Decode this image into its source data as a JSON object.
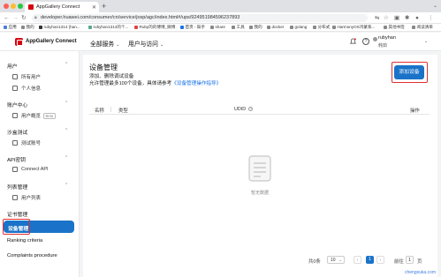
{
  "browser": {
    "tab_title": "AppGallery Connect",
    "url": "developer.huawei.com/consumer/cn/service/josp/agc/index.html#/ups/924951984596237893",
    "bookmarks": [
      "应用",
      "我的",
      "rubyhan1314 (han...",
      "rubyhan1314的个...",
      "Ruby的的博博_微博",
      "首页 - 知乎",
      "share",
      "工具",
      "我的",
      "docker",
      "golang",
      "分布式",
      "HarmonyOS鸿蒙系...",
      "其他书签",
      "阅读清单"
    ]
  },
  "header": {
    "brand": "AppGallery Connect",
    "nav": [
      "全部服务",
      "用户与访问"
    ],
    "user_name": "rubyhan",
    "user_role": "韩茹"
  },
  "sidebar": {
    "groups": [
      {
        "label": "用户",
        "items": [
          {
            "label": "所有用户"
          },
          {
            "label": "个人信息"
          }
        ]
      },
      {
        "label": "账户中心",
        "items": [
          {
            "label": "用户概览",
            "badge": "Beta"
          }
        ]
      },
      {
        "label": "沙盒测试",
        "items": [
          {
            "label": "测试账号"
          }
        ]
      },
      {
        "label": "API密钥",
        "items": [
          {
            "label": "Connect API"
          }
        ]
      },
      {
        "label": "列表管理",
        "items": [
          {
            "label": "用户列表"
          }
        ]
      },
      {
        "label": "证书管理",
        "items": []
      }
    ],
    "active_item": "设备管理",
    "bottom_items": [
      "Ranking criteria",
      "Complaints procedure"
    ]
  },
  "main": {
    "title": "设备管理",
    "desc1": "添加、删除调试设备",
    "desc2_prefix": "允许管理最多100个设备，具体请参考",
    "desc2_link": "《设备管理操作指导》",
    "add_button": "添加设备",
    "columns": [
      "名称",
      "类型",
      "UDID",
      "操作"
    ],
    "empty_text": "暂无数据",
    "pagination": {
      "total_label": "共0条",
      "page_size": "10",
      "current_page": "1",
      "goto_label": "前往",
      "goto_value": "1",
      "page_unit": "页"
    }
  },
  "watermark": "chengxuka.com",
  "colors": {
    "primary": "#1a73c8",
    "brand_red": "#d7000f",
    "highlight_box": "#e02f2f"
  }
}
